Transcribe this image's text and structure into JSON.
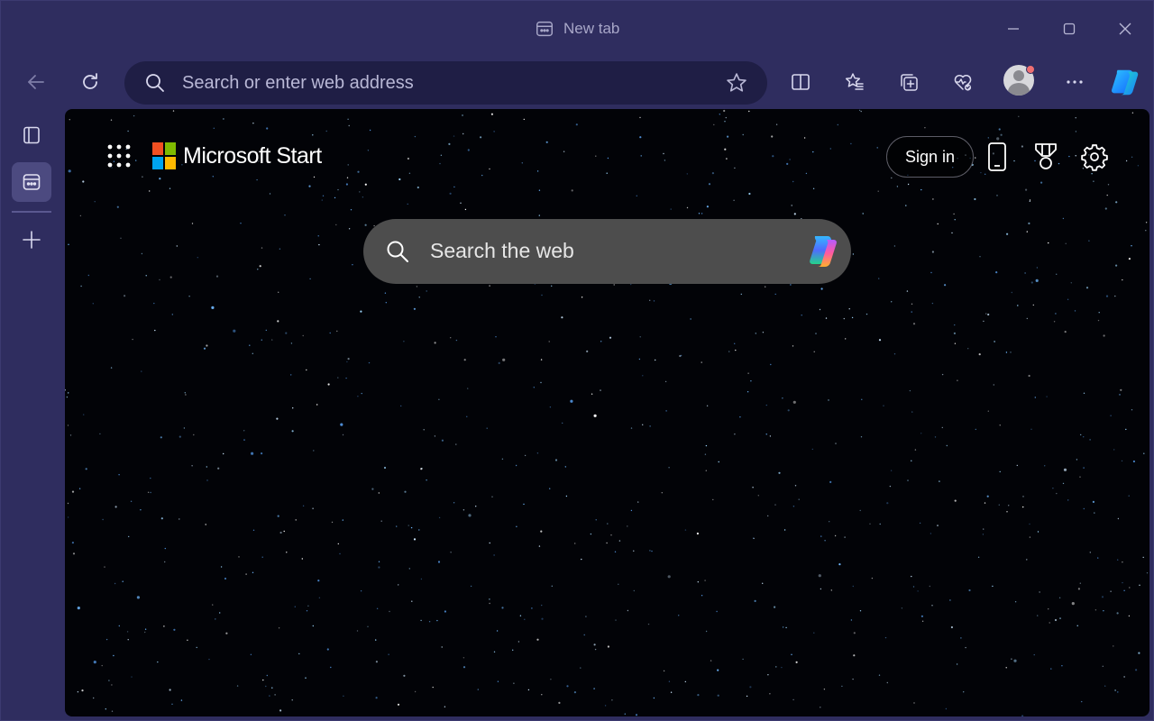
{
  "window": {
    "tab_title": "New tab"
  },
  "toolbar": {
    "address_placeholder": "Search or enter web address",
    "address_value": ""
  },
  "page": {
    "brand_name": "Microsoft Start",
    "sign_in_label": "Sign in",
    "search_placeholder": "Search the web"
  },
  "icons": {
    "tab": "tab-icon",
    "minimize": "minimize-icon",
    "maximize": "maximize-icon",
    "close": "close-icon",
    "back": "back-arrow-icon",
    "refresh": "refresh-icon",
    "search": "search-icon",
    "favorite_add": "star-icon",
    "split_screen": "split-screen-icon",
    "favorites": "favorites-icon",
    "collections": "collections-icon",
    "browser_essentials": "heart-pulse-icon",
    "profile": "profile-avatar",
    "more": "more-icon",
    "copilot": "copilot-icon",
    "tab_actions": "tab-actions-icon",
    "new_tab_page": "new-tab-page-icon",
    "new_tab": "plus-icon",
    "app_launcher": "app-launcher-icon",
    "phone": "phone-icon",
    "rewards": "trophy-icon",
    "settings": "gear-icon"
  },
  "colors": {
    "chrome_background": "#2f2d5f",
    "address_bar": "#1f1e45",
    "page_background": "#020307",
    "search_box": "#4d4d4d",
    "profile_badge": "#ef6f72"
  }
}
